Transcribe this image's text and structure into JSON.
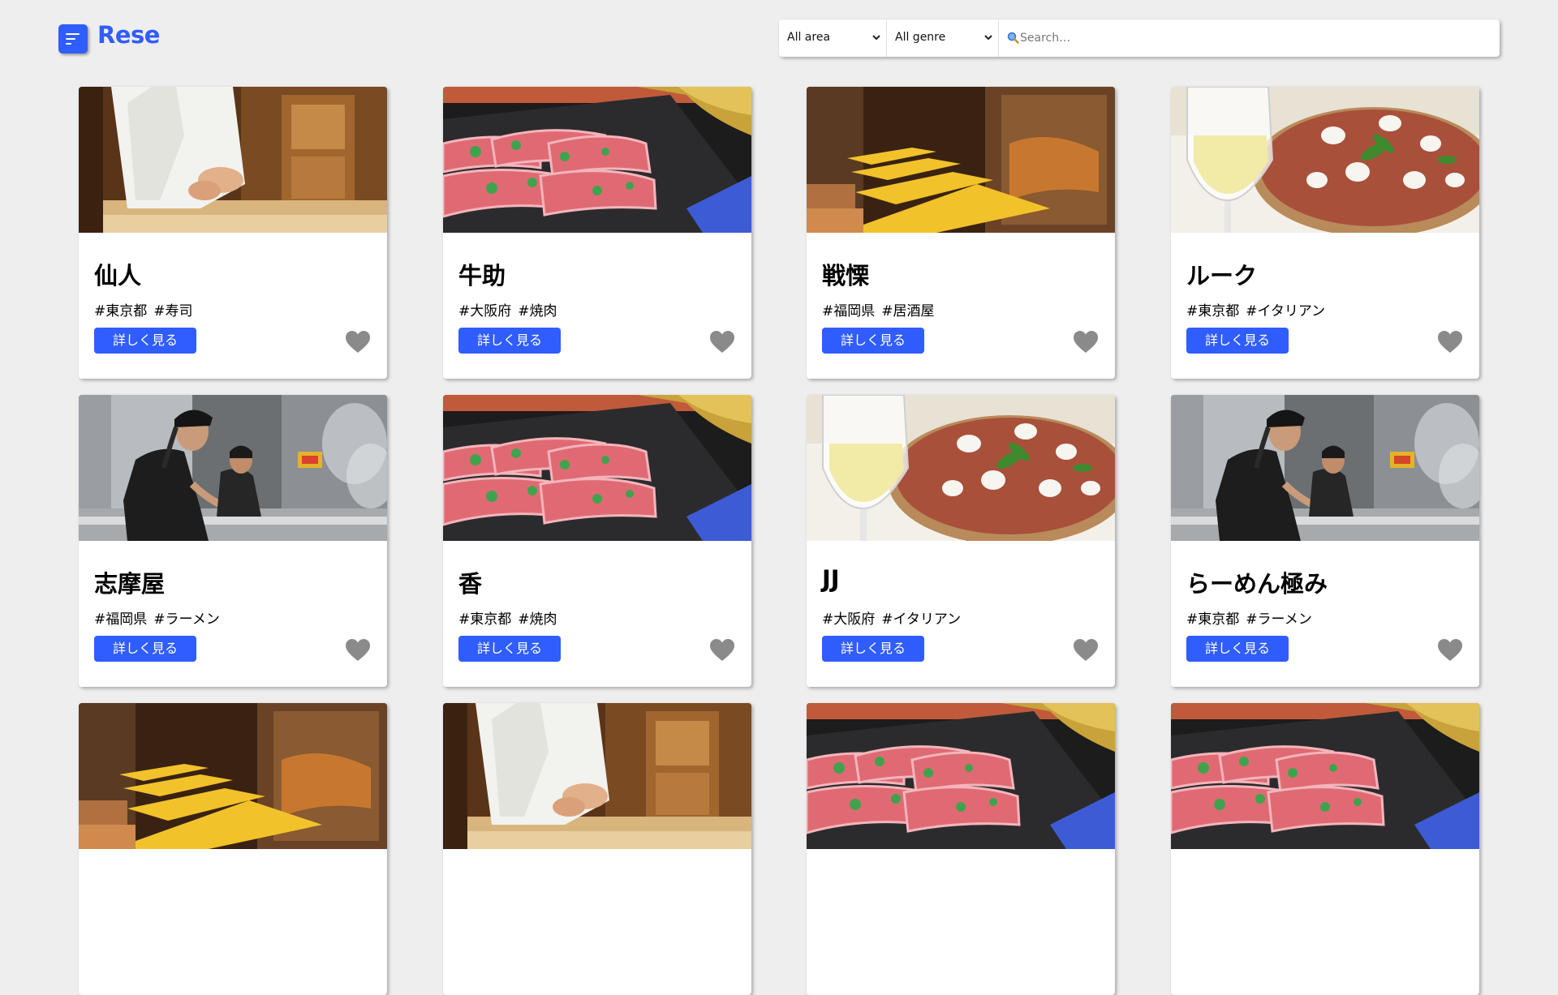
{
  "header": {
    "logo": "Rese",
    "menu_icon": "hamburger-menu-icon"
  },
  "search": {
    "area_selected": "All area",
    "genre_selected": "All genre",
    "placeholder": "Search…",
    "value": ""
  },
  "colors": {
    "accent": "#305dff",
    "background": "#eeeeee",
    "heart_inactive": "#8a8a8a"
  },
  "shops": [
    {
      "name": "仙人",
      "area": "#東京都",
      "genre": "#寿司",
      "image": "sushi-chef",
      "button": "詳しく見る"
    },
    {
      "name": "牛助",
      "area": "#大阪府",
      "genre": "#焼肉",
      "image": "yakiniku-meat",
      "button": "詳しく見る"
    },
    {
      "name": "戦慄",
      "area": "#福岡県",
      "genre": "#居酒屋",
      "image": "izakaya-tables",
      "button": "詳しく見る"
    },
    {
      "name": "ルーク",
      "area": "#東京都",
      "genre": "#イタリアン",
      "image": "pizza-wine",
      "button": "詳しく見る"
    },
    {
      "name": "志摩屋",
      "area": "#福岡県",
      "genre": "#ラーメン",
      "image": "ramen-kitchen",
      "button": "詳しく見る"
    },
    {
      "name": "香",
      "area": "#東京都",
      "genre": "#焼肉",
      "image": "yakiniku-meat",
      "button": "詳しく見る"
    },
    {
      "name": "JJ",
      "area": "#大阪府",
      "genre": "#イタリアン",
      "image": "pizza-wine",
      "button": "詳しく見る"
    },
    {
      "name": "らーめん極み",
      "area": "#東京都",
      "genre": "#ラーメン",
      "image": "ramen-kitchen",
      "button": "詳しく見る"
    },
    {
      "image": "izakaya-tables"
    },
    {
      "image": "sushi-chef"
    },
    {
      "image": "yakiniku-meat"
    },
    {
      "image": "yakiniku-meat"
    }
  ]
}
